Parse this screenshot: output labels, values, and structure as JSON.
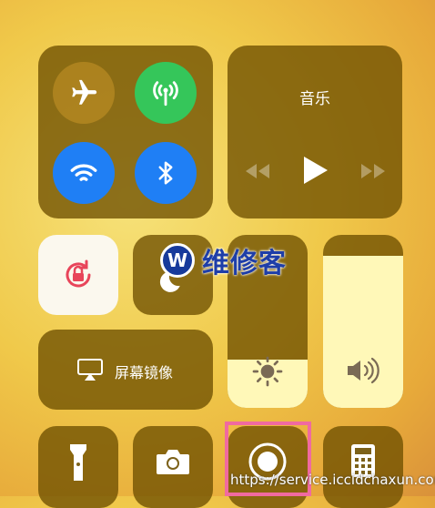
{
  "media": {
    "title": "音乐",
    "prev_icon": "rewind-icon",
    "play_icon": "play-icon",
    "next_icon": "fast-forward-icon"
  },
  "connectivity": {
    "airplane": {
      "icon": "airplane-icon",
      "on": false
    },
    "cellular": {
      "icon": "cellular-antenna-icon",
      "on": true
    },
    "wifi": {
      "icon": "wifi-icon",
      "on": true
    },
    "bluetooth": {
      "icon": "bluetooth-icon",
      "on": true
    }
  },
  "controls": {
    "rotation_lock": {
      "icon": "rotation-lock-icon",
      "on": true
    },
    "do_not_disturb": {
      "icon": "moon-icon",
      "on": false
    },
    "screen_mirroring": {
      "label": "屏幕镜像",
      "icon": "airplay-icon"
    }
  },
  "sliders": {
    "brightness": {
      "icon": "sun-icon",
      "level": 0.28
    },
    "volume": {
      "icon": "speaker-icon",
      "level": 0.88
    }
  },
  "bottom_row": [
    {
      "name": "flashlight",
      "icon": "flashlight-icon"
    },
    {
      "name": "camera",
      "icon": "camera-icon"
    },
    {
      "name": "screen-record",
      "icon": "record-icon"
    },
    {
      "name": "calculator",
      "icon": "calculator-icon"
    }
  ],
  "watermark": {
    "logo": "W",
    "text": "维修客"
  },
  "url": "https://service.iccidchaxun.com",
  "colors": {
    "blue": "#1f7ff5",
    "green": "#35c65a",
    "lock_red": "#e8455a",
    "highlight": "#f06aa0"
  }
}
